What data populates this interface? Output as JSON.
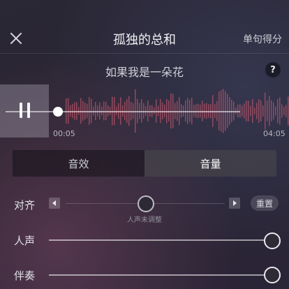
{
  "header": {
    "title": "孤独的总和",
    "score_mode": "单句得分",
    "close_icon": "close-icon"
  },
  "lyric": {
    "line": "如果我是一朵花",
    "help_label": "?"
  },
  "player": {
    "state_icon": "pause-icon",
    "time_start": "00:05",
    "time_end": "04:05",
    "progress_fraction": 0.02
  },
  "tabs": {
    "left": "音效",
    "right": "音量",
    "active": "right"
  },
  "controls": {
    "align_label": "对齐",
    "align_hint": "人声未调整",
    "align_value_fraction": 0.5,
    "reset_label": "重置",
    "vocal_label": "人声",
    "vocal_value_fraction": 1.0,
    "accompaniment_label": "伴奏",
    "accompaniment_value_fraction": 1.0
  },
  "colors": {
    "waveform": "#d25c70",
    "active_tab_bg": "#ffffff24",
    "accent_white": "#ffffff"
  }
}
